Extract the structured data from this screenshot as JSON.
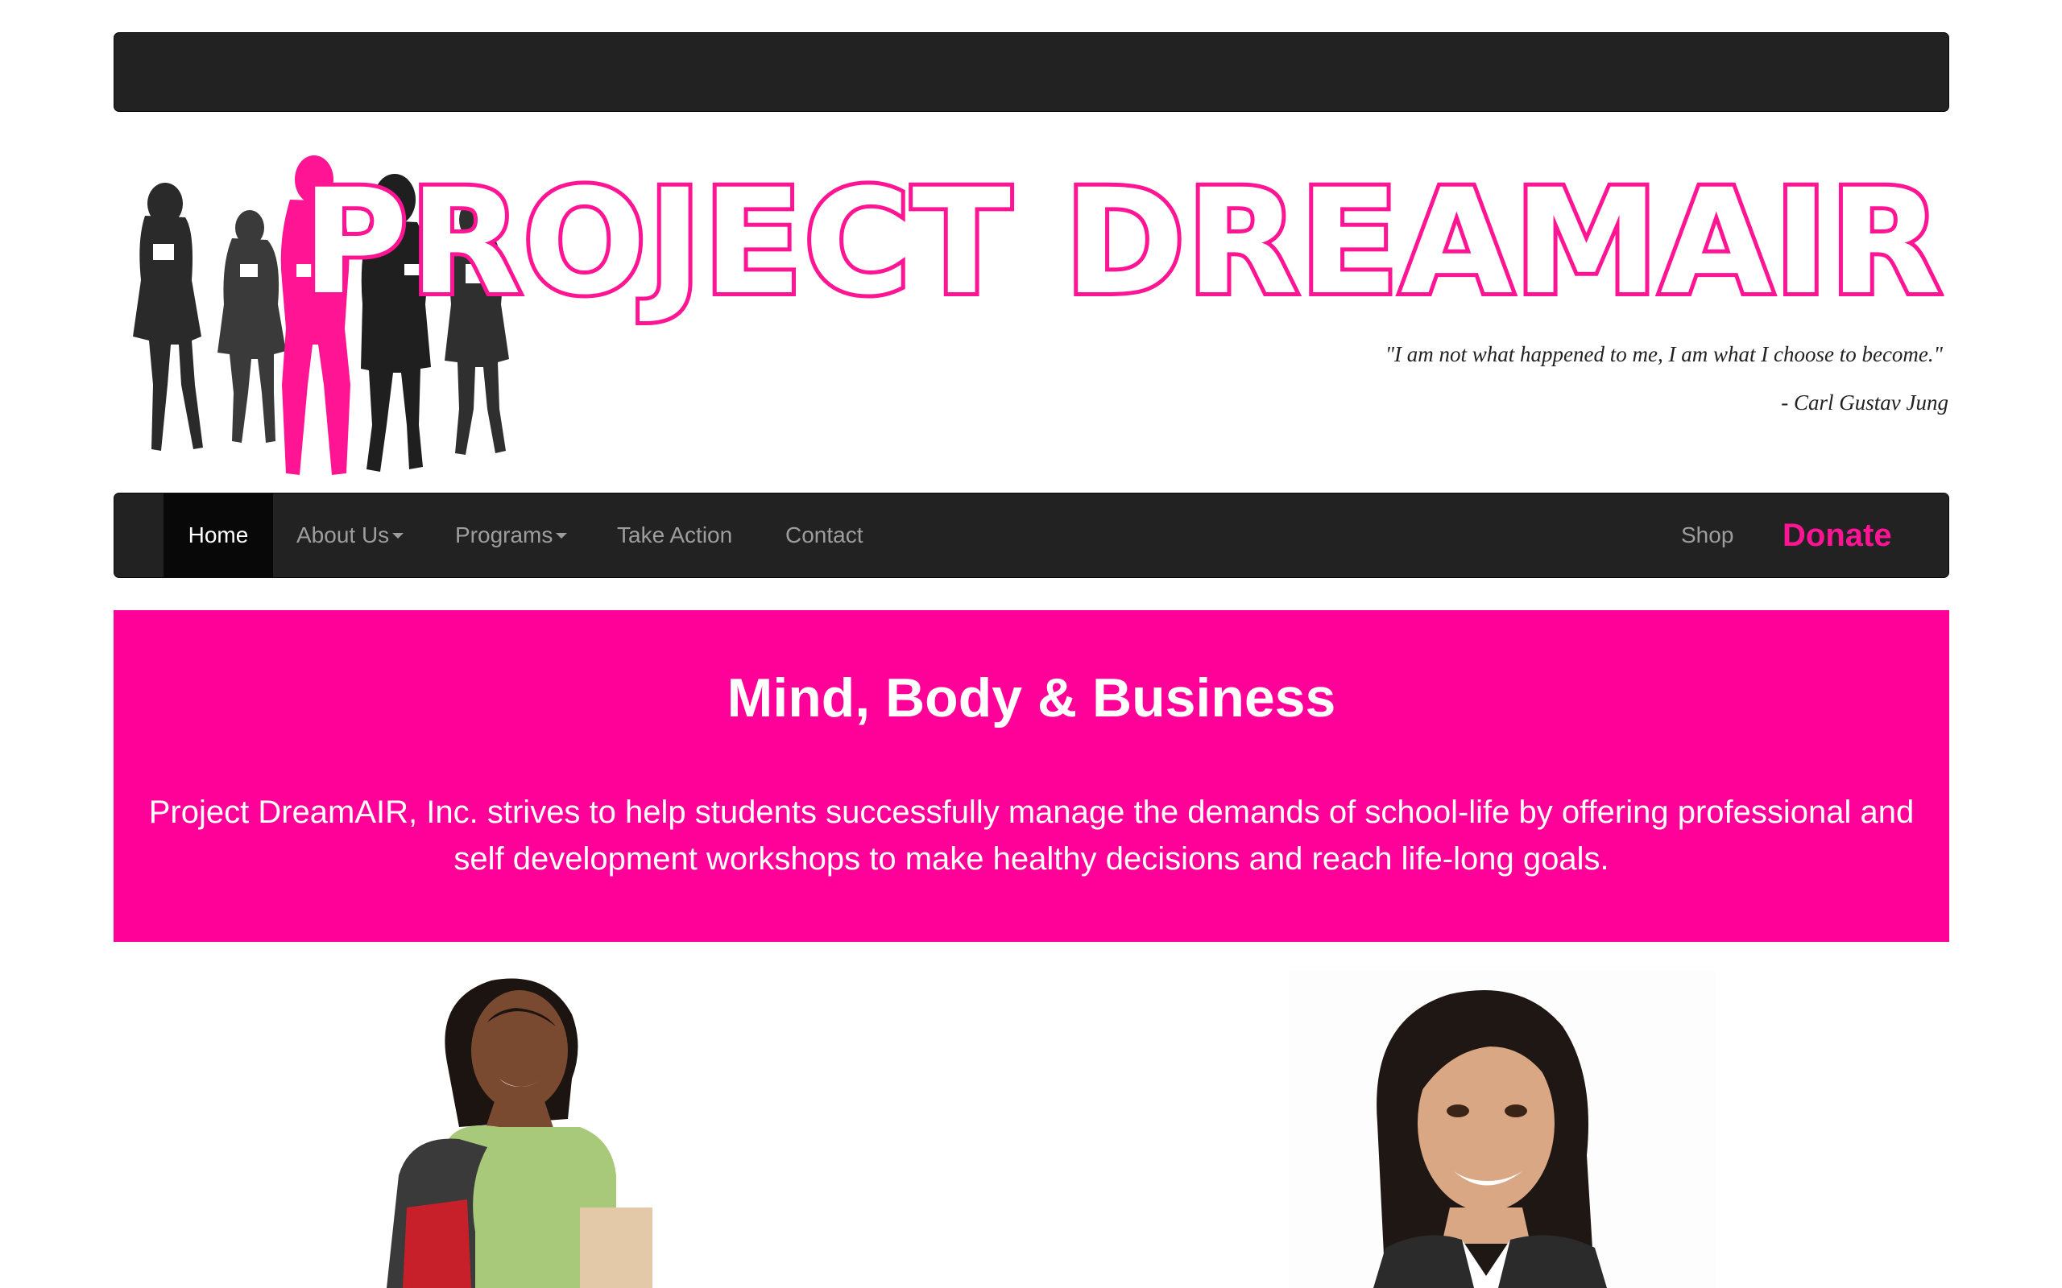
{
  "site": {
    "title": "Project DreamAIR",
    "quote": "\"I am not what happened to me, I am what I choose to become.\"",
    "quote_author": "- Carl Gustav Jung"
  },
  "nav": {
    "items": [
      {
        "label": "Home",
        "active": true
      },
      {
        "label": "About Us",
        "dropdown": true
      },
      {
        "label": "Programs",
        "dropdown": true
      },
      {
        "label": "Take Action"
      },
      {
        "label": "Contact"
      }
    ],
    "right_items": [
      {
        "label": "Shop"
      },
      {
        "label": "Donate"
      }
    ]
  },
  "hero": {
    "title": "Mind, Body & Business",
    "text": "Project DreamAIR, Inc. strives to help students successfully manage the demands of school-life by offering professional and self development workshops to make healthy decisions and reach life-long goals."
  },
  "colors": {
    "brand_pink": "#ff0099",
    "title_pink": "#ff1493",
    "navbar": "#222222",
    "nav_active": "#080808",
    "nav_text": "#9d9d9d"
  },
  "images": {
    "logo": "women-silhouettes-logo",
    "left_photo": "student-with-backpack-photo",
    "right_photo": "smiling-woman-photo"
  }
}
